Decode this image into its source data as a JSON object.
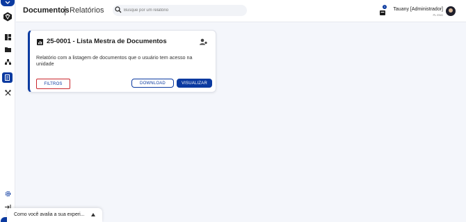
{
  "header": {
    "title": "Documentos",
    "subtitle": "Relatórios",
    "search_placeholder": "Busque por um relatório",
    "notification_count": "1",
    "user_name": "Tauany [Administrador]",
    "user_unit": "PL ENG"
  },
  "sidebar": {
    "items": [
      {
        "icon": "collapse-chevron-icon"
      },
      {
        "icon": "logo-icon"
      },
      {
        "icon": "dashboard-icon"
      },
      {
        "icon": "folder-icon"
      },
      {
        "icon": "hierarchy-icon"
      },
      {
        "icon": "reports-icon",
        "active": true
      },
      {
        "icon": "tools-icon"
      },
      {
        "icon": "settings-icon"
      },
      {
        "icon": "expand-sidebar-icon"
      }
    ]
  },
  "card": {
    "title": "25-0001 - Lista Mestra de Documentos",
    "description": "Relatório com a listagem de documentos que o usuário tem acesso na unidade",
    "filters_label": "FILTROS",
    "download_label": "DOWNLOAD",
    "view_label": "VISUALIZAR"
  },
  "feedback": {
    "label": "Como você avalia a sua experi..."
  },
  "colors": {
    "accent": "#0b3aa0",
    "highlight_border": "#c9252b",
    "background": "#f4f6fb"
  }
}
